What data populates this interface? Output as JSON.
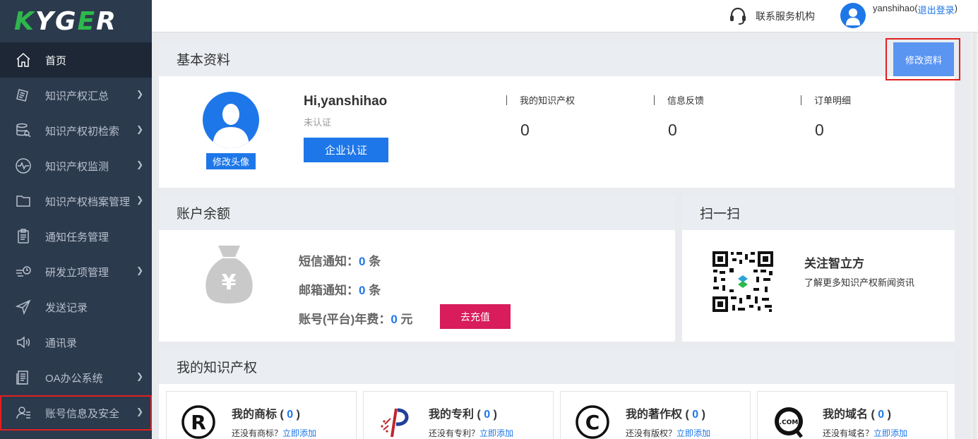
{
  "logo": {
    "text_a": "K",
    "text_b": "YG",
    "text_c": "E",
    "text_d": "R"
  },
  "sidebar": {
    "items": [
      {
        "label": "首页",
        "icon": "home-icon"
      },
      {
        "label": "知识产权汇总",
        "icon": "document-stack-icon"
      },
      {
        "label": "知识产权初检索",
        "icon": "database-search-icon"
      },
      {
        "label": "知识产权监测",
        "icon": "pulse-monitor-icon"
      },
      {
        "label": "知识产权档案管理",
        "icon": "folder-icon"
      },
      {
        "label": "通知任务管理",
        "icon": "clipboard-icon"
      },
      {
        "label": "研发立项管理",
        "icon": "rd-project-icon"
      },
      {
        "label": "发送记录",
        "icon": "send-icon"
      },
      {
        "label": "通讯录",
        "icon": "speaker-icon"
      },
      {
        "label": "OA办公系统",
        "icon": "office-doc-icon"
      },
      {
        "label": "账号信息及安全",
        "icon": "user-settings-icon"
      }
    ]
  },
  "topbar": {
    "service_label": "联系服务机构",
    "username": "yanshihao(",
    "logout_label": "退出登录",
    "close_paren": ")"
  },
  "profile": {
    "section_title": "基本资料",
    "edit_button": "修改资料",
    "avatar_button": "修改头像",
    "greeting": "Hi,yanshihao",
    "cert_status": "未认证",
    "cert_button": "企业认证",
    "stats": [
      {
        "label": "我的知识产权",
        "value": "0"
      },
      {
        "label": "信息反馈",
        "value": "0"
      },
      {
        "label": "订单明细",
        "value": "0"
      }
    ]
  },
  "balance": {
    "section_title": "账户余额",
    "sms_label": "短信通知：",
    "sms_value": "0",
    "sms_unit": " 条",
    "email_label": "邮箱通知：",
    "email_value": "0",
    "email_unit": " 条",
    "fee_label": "账号(平台)年费：",
    "fee_value": "0",
    "fee_unit": " 元",
    "recharge_button": "去充值"
  },
  "scan": {
    "section_title": "扫一扫",
    "follow_title": "关注智立方",
    "follow_sub": "了解更多知识产权新闻资讯"
  },
  "my_ip": {
    "section_title": "我的知识产权",
    "cards": [
      {
        "title": "我的商标",
        "count": "0",
        "empty_text": "还没有商标？",
        "add_link": "立即添加",
        "icon": "registered-trademark-icon"
      },
      {
        "title": "我的专利",
        "count": "0",
        "empty_text": "还没有专利？",
        "add_link": "立即添加",
        "icon": "patent-logo-icon"
      },
      {
        "title": "我的著作权",
        "count": "0",
        "empty_text": "还没有版权？",
        "add_link": "立即添加",
        "icon": "copyright-icon"
      },
      {
        "title": "我的域名",
        "count": "0",
        "empty_text": "还没有域名？",
        "add_link": "立即添加",
        "icon": "domain-com-icon"
      }
    ]
  },
  "colors": {
    "sidebar": "#2c3a4d",
    "primary": "#1e77e8",
    "recharge": "#d81c5c",
    "highlight": "#e02020"
  }
}
